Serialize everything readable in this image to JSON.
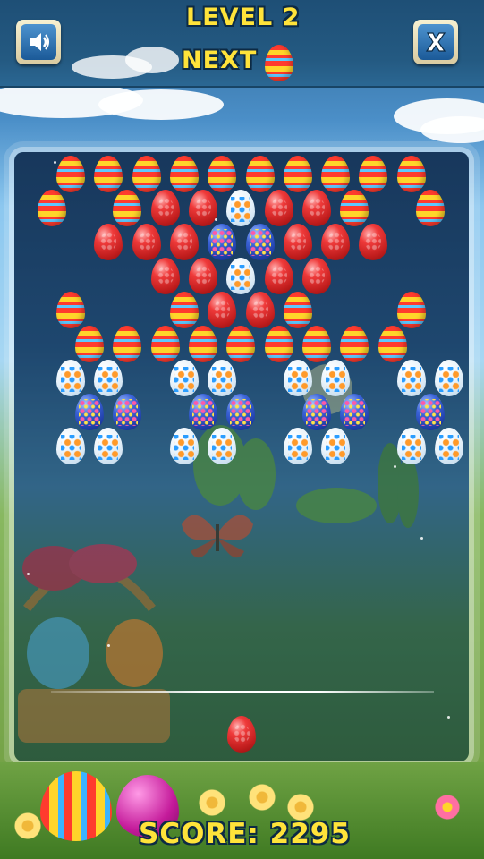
{
  "header": {
    "level_text": "LEVEL 2",
    "next_text": "NEXT",
    "next_egg": "striped",
    "sound_icon": "speaker-icon",
    "close_icon": "x-icon"
  },
  "footer": {
    "score_text": "SCORE: 2295"
  },
  "shooter_egg": "red",
  "grid": {
    "rows": [
      {
        "offset": false,
        "cells": [
          "striped",
          "striped",
          "striped",
          "striped",
          "striped",
          "striped",
          "striped",
          "striped",
          "striped",
          "striped",
          ""
        ]
      },
      {
        "offset": true,
        "cells": [
          "striped",
          "",
          "striped",
          "red",
          "red",
          "white",
          "red",
          "red",
          "striped",
          "",
          "striped"
        ]
      },
      {
        "offset": false,
        "cells": [
          "",
          "red",
          "red",
          "red",
          "blue",
          "blue",
          "red",
          "red",
          "red",
          "",
          ""
        ]
      },
      {
        "offset": true,
        "cells": [
          "",
          "",
          "",
          "red",
          "red",
          "white",
          "red",
          "red",
          "",
          "",
          ""
        ]
      },
      {
        "offset": false,
        "cells": [
          "striped",
          "",
          "",
          "striped",
          "red",
          "red",
          "striped",
          "",
          "",
          "striped",
          ""
        ]
      },
      {
        "offset": true,
        "cells": [
          "",
          "striped",
          "striped",
          "striped",
          "striped",
          "striped",
          "striped",
          "striped",
          "striped",
          "striped",
          ""
        ]
      },
      {
        "offset": false,
        "cells": [
          "white",
          "white",
          "",
          "white",
          "white",
          "",
          "white",
          "white",
          "",
          "white",
          "white"
        ]
      },
      {
        "offset": true,
        "cells": [
          "",
          "blue",
          "blue",
          "",
          "blue",
          "blue",
          "",
          "blue",
          "blue",
          "",
          "blue"
        ]
      },
      {
        "offset": false,
        "cells": [
          "white",
          "white",
          "",
          "white",
          "white",
          "",
          "white",
          "white",
          "",
          "white",
          "white"
        ]
      }
    ]
  },
  "colors": {
    "title_yellow": "#ffe33a",
    "header_blue": "#245a82"
  }
}
